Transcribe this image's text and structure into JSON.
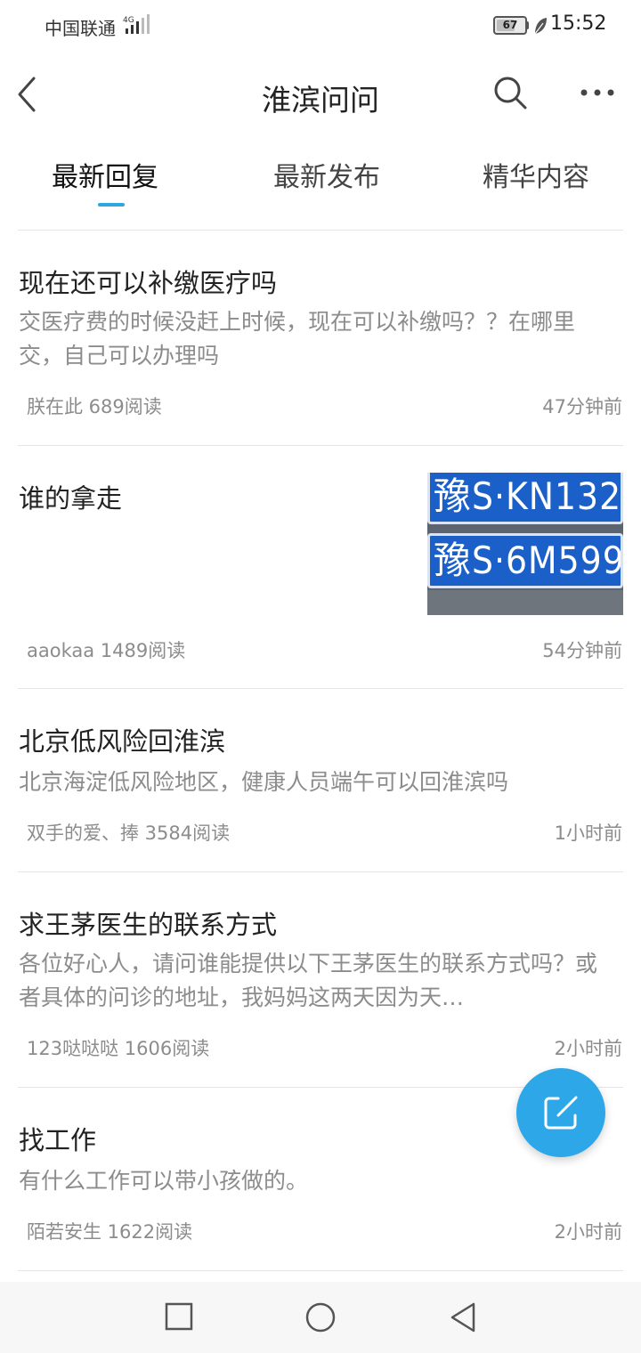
{
  "status_bar": {
    "carrier": "中国联通",
    "network": "4G",
    "battery": "67",
    "battery_level": 0.67,
    "time": "15:52"
  },
  "nav": {
    "title": "淮滨问问"
  },
  "tabs": [
    {
      "label": "最新回复",
      "active": true
    },
    {
      "label": "最新发布",
      "active": false
    },
    {
      "label": "精华内容",
      "active": false
    }
  ],
  "posts": [
    {
      "title": "现在还可以补缴医疗吗",
      "body": "交医疗费的时候没赶上时候，现在可以补缴吗？？在哪里交，自己可以办理吗",
      "meta": "朕在此 689阅读",
      "time": "47分钟前"
    },
    {
      "title": "谁的拿走",
      "body": "",
      "meta": "aaokaa 1489阅读",
      "time": "54分钟前",
      "image": {
        "plate_1": "豫S·KN132",
        "plate_2": "豫S·6M599"
      }
    },
    {
      "title": "北京低风险回淮滨",
      "body": "北京海淀低风险地区，健康人员端午可以回淮滨吗",
      "meta": "双手的爱、捧 3584阅读",
      "time": "1小时前"
    },
    {
      "title": "求王茅医生的联系方式",
      "body": "各位好心人，请问谁能提供以下王茅医生的联系方式吗？或者具体的问诊的地址，我妈妈这两天因为天…",
      "meta": "123哒哒哒 1606阅读",
      "time": "2小时前"
    },
    {
      "title": "找工作",
      "body": "有什么工作可以带小孩做的。",
      "meta": "陌若安生 1622阅读",
      "time": "2小时前"
    }
  ],
  "icons": {
    "back": "back-arrow-icon",
    "search": "search-icon",
    "more": "more-dots-icon",
    "compose": "compose-icon",
    "home": "square-icon",
    "circle": "circle-icon",
    "back_nav": "triangle-back-icon"
  },
  "colors": {
    "accent": "#2ea7e0",
    "fab": "#2ea7e8",
    "plate": "#1b5fc9"
  }
}
